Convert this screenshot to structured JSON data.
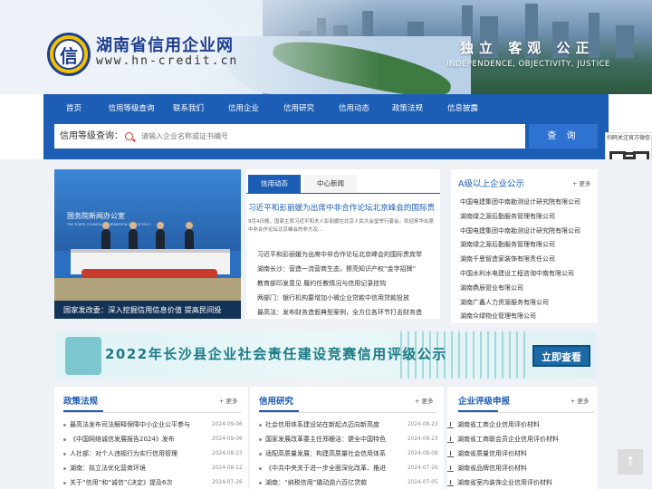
{
  "header": {
    "logo_char": "信",
    "site_title": "湖南省信用企业网",
    "site_url": "www.hn-credit.cn",
    "slogan": "独立  客观  公正",
    "slogan_en": "INDEPENDENCE, OBJECTIVITY, JUSTICE"
  },
  "nav": {
    "items": [
      "首页",
      "信用等级查询",
      "联系我们",
      "信用企业",
      "信用研究",
      "信用动态",
      "政策法规",
      "信息披露"
    ]
  },
  "search": {
    "label": "信用等级查询：",
    "placeholder": "请输入企业名称或证书编号",
    "button": "查 询"
  },
  "qr": {
    "label": "扫码关注官方微信"
  },
  "slider": {
    "sign_cn": "国务院新闻办公室",
    "sign_en": "THE STATE COUNCIL INFORMATION OFFICE P.R.C.",
    "caption": "国家发改委：深入挖掘信用信息价值 提高民间投"
  },
  "news": {
    "tab_active": "信用动态",
    "tab_inactive": "中心新闻",
    "headline": "习近平和彭丽媛为出席中非合作论坛北京峰会的国际贵",
    "summary": "9月4日晚，国家主席习近平和夫人彭丽媛在北京人民大会堂举行宴会，欢迎来华出席中非合作论坛北京峰会的非方及...",
    "items": [
      "习近平和彭丽媛为出席中非合作论坛北京峰会的国际贵宾举",
      "湖南长沙：营造一流营商生态，擦亮知识产权“金字招牌”",
      "教育部印发意见 履约任教情况与信用记录挂钩",
      "两部门：银行机构要增加小微企业贷款中信用贷款投放",
      "最高法：发布财务造假典型案例，全方位各环节打击财务造"
    ]
  },
  "alevel": {
    "title": "A级以上企业公示",
    "more": "+ 更多",
    "items": [
      "中国电建集团中南勘测设计研究院有限公司",
      "湖南绿之源后勤服务管理有限公司",
      "中国电建集团中南勘测设计研究院有限公司",
      "湖南绿之源后勤服务管理有限公司",
      "湖南千思智造家装饰有限责任公司",
      "中国水利水电建设工程咨询中南有限公司",
      "湖南鼎辰管业有限公司",
      "湖南广鑫人力资源服务有限公司",
      "湖南众绿物业管理有限公司"
    ]
  },
  "promo": {
    "title": "2022年长沙县企业社会责任建设竞赛信用评级公示",
    "button": "立即查看"
  },
  "panels": {
    "policy": {
      "title": "政策法规",
      "more": "+ 更多",
      "rows": [
        {
          "text": "最高法发布司法解释保障中小企业公平参与",
          "date": "2024-09-06"
        },
        {
          "text": "《中国网络诚信发展报告2024》发布",
          "date": "2024-09-06"
        },
        {
          "text": "人社部：对个人违规行为实行信用管理",
          "date": "2024-08-23"
        },
        {
          "text": "湖南：拟立法优化营商环境",
          "date": "2024-08-12"
        },
        {
          "text": "关于“信用”和“诚信”《决定》提及6次",
          "date": "2024-07-26"
        }
      ]
    },
    "research": {
      "title": "信用研究",
      "more": "+ 更多",
      "rows": [
        {
          "text": "社会信用体系建设站在新起点迈向新高度",
          "date": "2024-08-23"
        },
        {
          "text": "国家发展改革委主任郑栅洁：健全中国特色",
          "date": "2024-08-23"
        },
        {
          "text": "适配高质量发展：构建高质量社会信用体系",
          "date": "2024-08-08"
        },
        {
          "text": "《中共中央关于进一步全面深化改革、推进",
          "date": "2024-07-26"
        },
        {
          "text": "湖南：“纳税信用”撬动逾六百亿贷款",
          "date": "2024-07-05"
        }
      ]
    },
    "rating": {
      "title": "企业评级申报",
      "more": "+ 更多",
      "rows": [
        "湖南省工商企业信用评价材料",
        "湖南省工商联会员企业信用评价材料",
        "湖南省质量信用评价材料",
        "湖南省品牌信用评价材料",
        "湖南省室内装饰企业信用评价材料"
      ]
    }
  },
  "totop": "↑"
}
